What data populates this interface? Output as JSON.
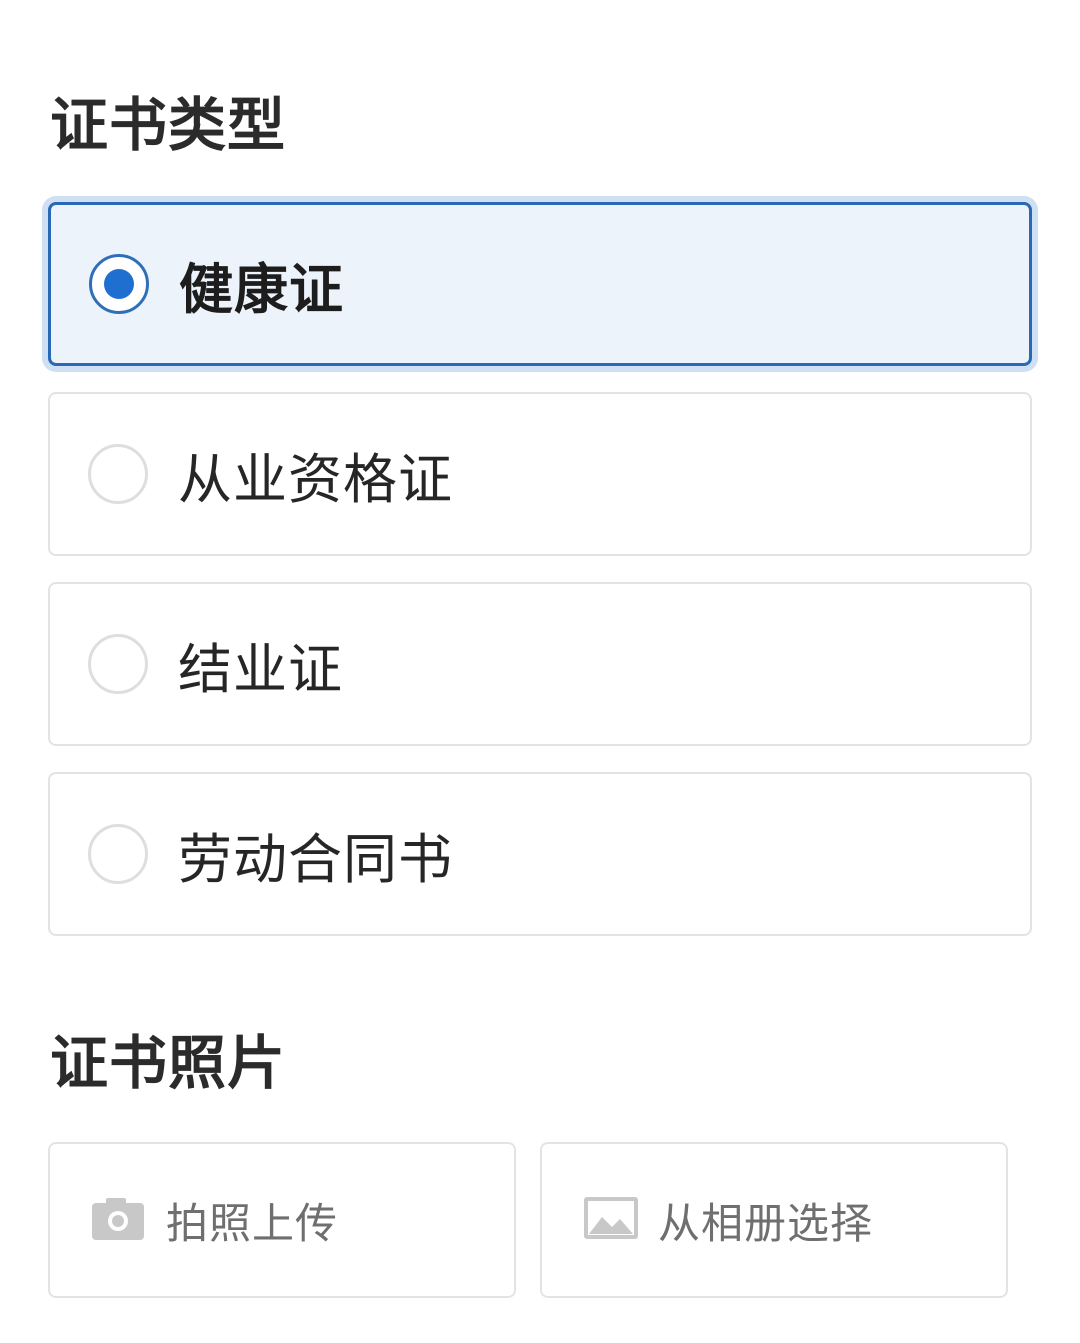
{
  "sections": {
    "certificate_type_title": "证书类型",
    "certificate_photo_title": "证书照片"
  },
  "options": [
    {
      "label": "健康证",
      "selected": true
    },
    {
      "label": "从业资格证",
      "selected": false
    },
    {
      "label": "结业证",
      "selected": false
    },
    {
      "label": "劳动合同书",
      "selected": false
    }
  ],
  "upload": {
    "camera_label": "拍照上传",
    "album_label": "从相册选择",
    "camera_icon": "camera-icon",
    "album_icon": "image-icon"
  },
  "colors": {
    "accent": "#1f6fd0",
    "selected_border": "#2868b5",
    "selected_background": "#edf3fb",
    "icon_gray": "#c8c8c8"
  }
}
